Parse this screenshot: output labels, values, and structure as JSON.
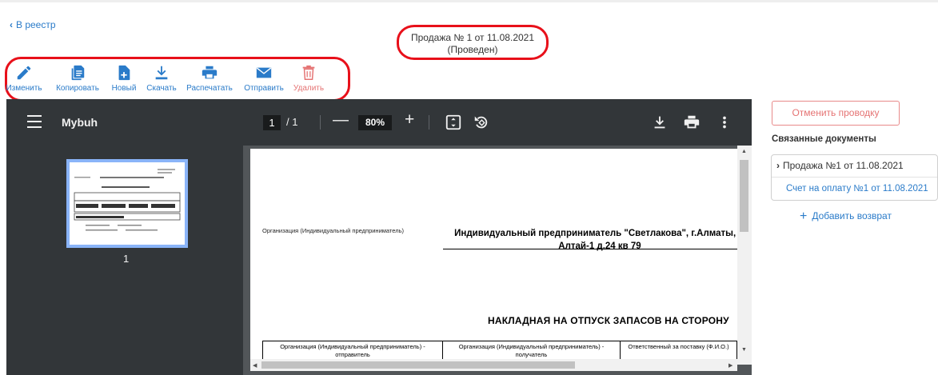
{
  "nav": {
    "back_label": "В реестр"
  },
  "document": {
    "title": "Продажа № 1 от 11.08.2021",
    "status": "(Проведен)"
  },
  "toolbar": {
    "edit": "Изменить",
    "copy": "Копировать",
    "new": "Новый",
    "download": "Скачать",
    "print": "Распечатать",
    "send": "Отправить",
    "delete": "Удалить"
  },
  "viewer": {
    "title": "Mybuh",
    "current_page": "1",
    "total_pages": "1",
    "zoom": "80%",
    "thumbnail_number": "1",
    "icons": [
      "menu-icon",
      "fit-page-icon",
      "rotate-icon",
      "download-icon",
      "print-icon",
      "more-icon"
    ]
  },
  "pdf": {
    "org_label": "Организация (Индивидуальный предприниматель)",
    "org_value_line1": "Индивидуальный предприниматель \"Светлакова\", г.Алматы, м",
    "org_value_line2": "Алтай-1 д.24 кв 79",
    "heading": "НАКЛАДНАЯ НА ОТПУСК ЗАПАСОВ НА СТОРОНУ",
    "table_headers": [
      "Организация (Индивидуальный предприниматель) - отправитель",
      "Организация (Индивидуальный предприниматель) - получатель",
      "Ответственный за поставку (Ф.И.О.)"
    ]
  },
  "sidebar": {
    "cancel_button": "Отменить проводку",
    "related_title": "Связанные документы",
    "related_items": [
      "Продажа №1 от 11.08.2021",
      "Счет на оплату №1 от 11.08.2021"
    ],
    "add_return": "Добавить возврат"
  },
  "colors": {
    "link": "#2a7bc9",
    "danger": "#e57373",
    "highlight": "#e8101a",
    "viewer_bar": "#323639"
  }
}
